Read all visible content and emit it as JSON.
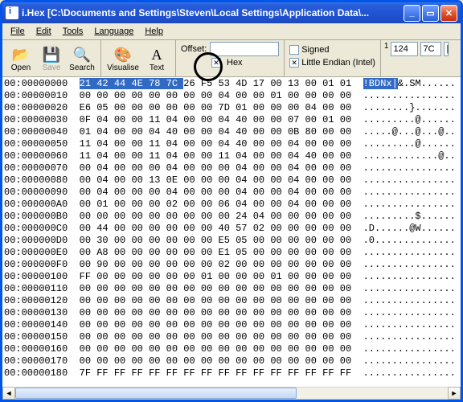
{
  "window": {
    "title": "i.Hex [C:\\Documents and Settings\\Steven\\Local Settings\\Application Data\\..."
  },
  "menu": {
    "file": "File",
    "edit": "Edit",
    "tools": "Tools",
    "language": "Language",
    "help": "Help"
  },
  "toolbar": {
    "open": "Open",
    "save": "Save",
    "search": "Search",
    "visualise": "Visualise",
    "text": "Text",
    "offset_label": "Offset:",
    "offset_value": "",
    "hex_label": "Hex",
    "signed_label": "Signed",
    "endian_label": "Little Endian (Intel)",
    "val1": "1",
    "val2": "124",
    "val3": "7C",
    "val4": "|"
  },
  "hex_rows": [
    {
      "addr": "00:00000000",
      "bytes": "21 42 44 4E 78 7C 26 F5 53 4D 17 00 13 00 01 01",
      "ascii": "!BDNx|&.SM......",
      "sel_bytes": 6,
      "sel_ascii": 6
    },
    {
      "addr": "00:00000010",
      "bytes": "00 00 00 00 00 00 00 00 04 00 00 01 00 00 00 00",
      "ascii": "................"
    },
    {
      "addr": "00:00000020",
      "bytes": "E6 05 00 00 00 00 00 00 7D 01 00 00 00 04 00 00",
      "ascii": "........}......."
    },
    {
      "addr": "00:00000030",
      "bytes": "0F 04 00 00 11 04 00 00 04 40 00 00 07 00 01 00",
      "ascii": ".........@......"
    },
    {
      "addr": "00:00000040",
      "bytes": "01 04 00 00 04 40 00 00 04 40 00 00 0B 80 00 00",
      "ascii": ".....@...@...@.."
    },
    {
      "addr": "00:00000050",
      "bytes": "11 04 00 00 11 04 00 00 04 40 00 00 04 00 00 00",
      "ascii": ".........@......"
    },
    {
      "addr": "00:00000060",
      "bytes": "11 04 00 00 11 04 00 00 11 04 00 00 04 40 00 00",
      "ascii": ".............@.."
    },
    {
      "addr": "00:00000070",
      "bytes": "00 04 00 00 00 04 00 00 00 04 00 00 04 00 00 00",
      "ascii": "................"
    },
    {
      "addr": "00:00000080",
      "bytes": "00 04 00 00 13 0E 00 00 00 04 00 00 04 00 00 00",
      "ascii": "................"
    },
    {
      "addr": "00:00000090",
      "bytes": "00 04 00 00 00 04 00 00 00 04 00 00 04 00 00 00",
      "ascii": "................"
    },
    {
      "addr": "00:000000A0",
      "bytes": "00 01 00 00 00 02 00 00 06 04 00 00 04 00 00 00",
      "ascii": "................"
    },
    {
      "addr": "00:000000B0",
      "bytes": "00 00 00 00 00 00 00 00 00 24 04 00 00 00 00 00",
      "ascii": ".........$......"
    },
    {
      "addr": "00:000000C0",
      "bytes": "00 44 00 00 00 00 00 00 40 57 02 00 00 00 00 00",
      "ascii": ".D......@W......"
    },
    {
      "addr": "00:000000D0",
      "bytes": "00 30 00 00 00 00 00 00 E5 05 00 00 00 00 00 00",
      "ascii": ".0.............."
    },
    {
      "addr": "00:000000E0",
      "bytes": "00 A8 00 00 00 00 00 00 E1 05 00 00 00 00 00 00",
      "ascii": "................"
    },
    {
      "addr": "00:000000F0",
      "bytes": "00 90 00 00 00 00 00 00 02 00 00 00 00 00 00 00",
      "ascii": "................"
    },
    {
      "addr": "00:00000100",
      "bytes": "FF 00 00 00 00 00 00 01 00 00 00 01 00 00 00 00",
      "ascii": "................"
    },
    {
      "addr": "00:00000110",
      "bytes": "00 00 00 00 00 00 00 00 00 00 00 00 00 00 00 00",
      "ascii": "................"
    },
    {
      "addr": "00:00000120",
      "bytes": "00 00 00 00 00 00 00 00 00 00 00 00 00 00 00 00",
      "ascii": "................"
    },
    {
      "addr": "00:00000130",
      "bytes": "00 00 00 00 00 00 00 00 00 00 00 00 00 00 00 00",
      "ascii": "................"
    },
    {
      "addr": "00:00000140",
      "bytes": "00 00 00 00 00 00 00 00 00 00 00 00 00 00 00 00",
      "ascii": "................"
    },
    {
      "addr": "00:00000150",
      "bytes": "00 00 00 00 00 00 00 00 00 00 00 00 00 00 00 00",
      "ascii": "................"
    },
    {
      "addr": "00:00000160",
      "bytes": "00 00 00 00 00 00 00 00 00 00 00 00 00 00 00 00",
      "ascii": "................"
    },
    {
      "addr": "00:00000170",
      "bytes": "00 00 00 00 00 00 00 00 00 00 00 00 00 00 00 00",
      "ascii": "................"
    },
    {
      "addr": "00:00000180",
      "bytes": "7F FF FF FF FF FF FF FF FF FF FF FF FF FF FF FF",
      "ascii": "................"
    }
  ]
}
